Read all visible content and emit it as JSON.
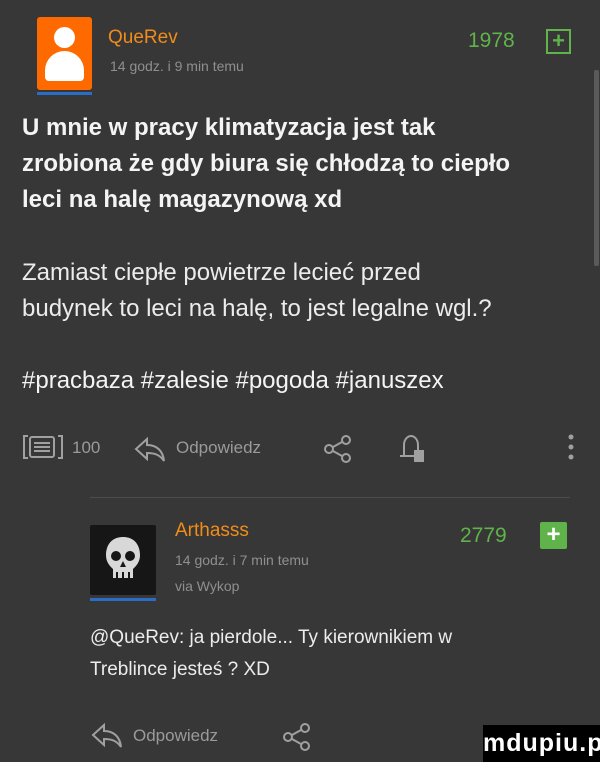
{
  "post": {
    "author": "QueRev",
    "time": "14 godz. i 9 min temu",
    "votes": "1978",
    "vote_symbol": "+",
    "bold_lines": [
      "U mnie w pracy klimatyzacja jest tak",
      "zrobiona że gdy biura się chłodzą to ciepło",
      "leci na halę magazynową xd"
    ],
    "text_lines": [
      "Zamiast ciepłe powietrze lecieć przed",
      "budynek to leci na halę, to jest legalne wgl.?"
    ],
    "tags": "#pracbaza #zalesie #pogoda #januszex",
    "comment_count": "100",
    "reply_label": "Odpowiedz"
  },
  "reply": {
    "author": "Arthasss",
    "time": "14 godz. i 7 min temu",
    "via": "via Wykop",
    "votes": "2779",
    "vote_symbol": "+",
    "lines": [
      "@QueRev: ja pierdole... Ty kierownikiem w",
      "Treblince jesteś ? XD"
    ],
    "reply_label": "Odpowiedz"
  },
  "watermark": "mdupiu.pl",
  "colors": {
    "background": "#373737",
    "username": "#f08c1a",
    "votes": "#5fb34a",
    "avatar": "#ff6a00",
    "underline": "#2b6cc4"
  }
}
